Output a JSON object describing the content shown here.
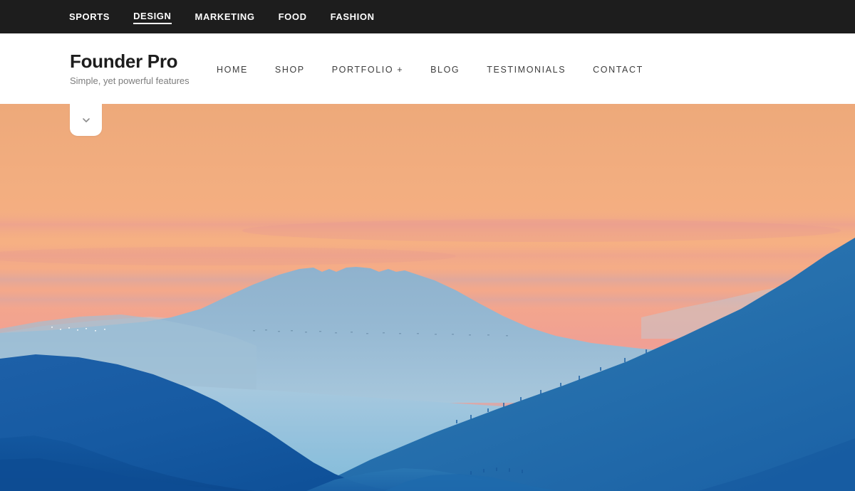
{
  "topbar": {
    "items": [
      {
        "label": "SPORTS",
        "active": false
      },
      {
        "label": "DESIGN",
        "active": true
      },
      {
        "label": "MARKETING",
        "active": false
      },
      {
        "label": "FOOD",
        "active": false
      },
      {
        "label": "FASHION",
        "active": false
      }
    ],
    "background_color": "#1d1d1d",
    "text_color": "#ffffff"
  },
  "header": {
    "brand_title": "Founder Pro",
    "brand_tagline": "Simple, yet powerful features",
    "nav": [
      {
        "label": "HOME"
      },
      {
        "label": "SHOP"
      },
      {
        "label": "PORTFOLIO +"
      },
      {
        "label": "BLOG"
      },
      {
        "label": "TESTIMONIALS"
      },
      {
        "label": "CONTACT"
      }
    ],
    "background_color": "#ffffff",
    "title_color": "#1d1d1d",
    "tagline_color": "#7d7d7d",
    "nav_color": "#3d3d3d"
  },
  "hero": {
    "tab_icon": "chevron-down-icon",
    "tab_icon_color": "#8c8c8c",
    "tab_background": "#ffffff",
    "scene": "sunset mountain landscape photograph",
    "colors": {
      "sky_top": "#eda97a",
      "sky_mid": "#f5ac81",
      "sky_pink": "#f3a293",
      "sky_haze": "#d9a8a6",
      "distant_ridge": "#9fbdd2",
      "volcano": "#93b7d1",
      "mid_haze": "#a6c6dc",
      "valley_fog": "#87bdda",
      "right_ridge": "#2a72b0",
      "left_ridge": "#1a5da5",
      "foreground_deep": "#0f56a0",
      "foreground_darkest": "#0c4a90"
    }
  }
}
